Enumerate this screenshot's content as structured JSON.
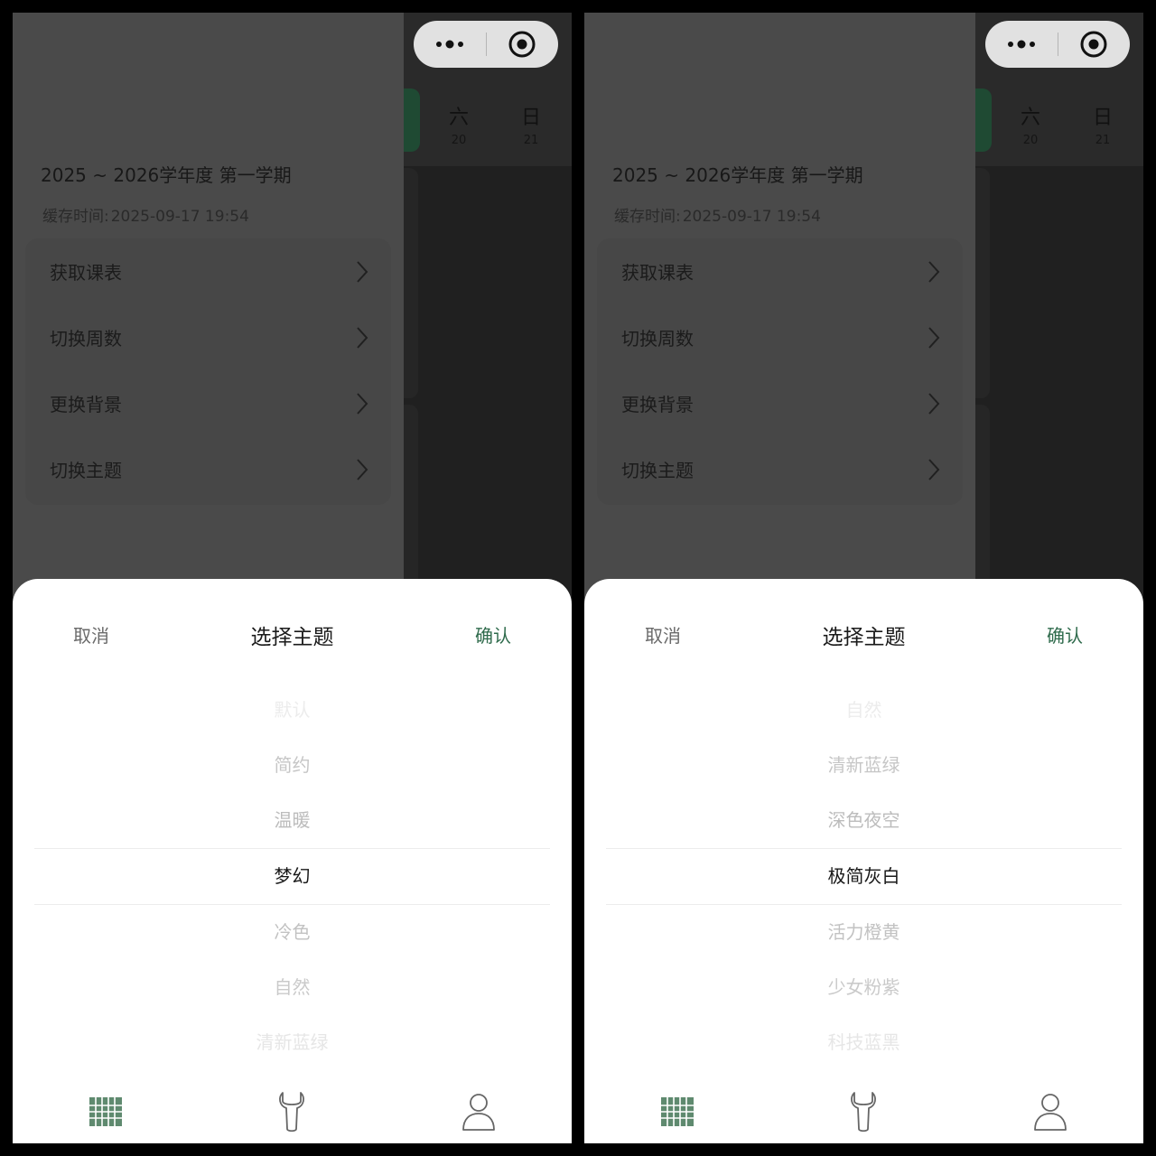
{
  "panels": [
    {
      "days": [
        {
          "label": "六",
          "date": "20"
        },
        {
          "label": "日",
          "date": "21"
        }
      ],
      "drawer": {
        "term": "2025 ~ 2026学年度 第一学期",
        "cache_label": "缓存时间:",
        "cache_time": "2025-09-17 19:54",
        "menu": [
          "获取课表",
          "切换周数",
          "更换背景",
          "切换主题"
        ]
      },
      "sheet": {
        "cancel": "取消",
        "title": "选择主题",
        "confirm": "确认",
        "options": [
          "默认",
          "简约",
          "温暖",
          "梦幻",
          "冷色",
          "自然",
          "清新蓝绿"
        ],
        "selected": "梦幻"
      }
    },
    {
      "days": [
        {
          "label": "六",
          "date": "20"
        },
        {
          "label": "日",
          "date": "21"
        }
      ],
      "drawer": {
        "term": "2025 ~ 2026学年度 第一学期",
        "cache_label": "缓存时间:",
        "cache_time": "2025-09-17 19:54",
        "menu": [
          "获取课表",
          "切换周数",
          "更换背景",
          "切换主题"
        ]
      },
      "sheet": {
        "cancel": "取消",
        "title": "选择主题",
        "confirm": "确认",
        "options": [
          "自然",
          "清新蓝绿",
          "深色夜空",
          "极简灰白",
          "活力橙黄",
          "少女粉紫",
          "科技蓝黑"
        ],
        "selected": "极简灰白"
      }
    }
  ],
  "icons": {
    "capsule_more": "more-dots-icon",
    "capsule_close": "target-close-icon",
    "menu_chevron": "chevron-right-icon",
    "tabs": [
      "schedule-grid-icon",
      "tools-wrench-icon",
      "user-profile-icon"
    ]
  },
  "colors": {
    "accent": "#2f6b4c",
    "tab_icon": "#5f8a6f",
    "overlay_dark": "#4a4a4a"
  }
}
